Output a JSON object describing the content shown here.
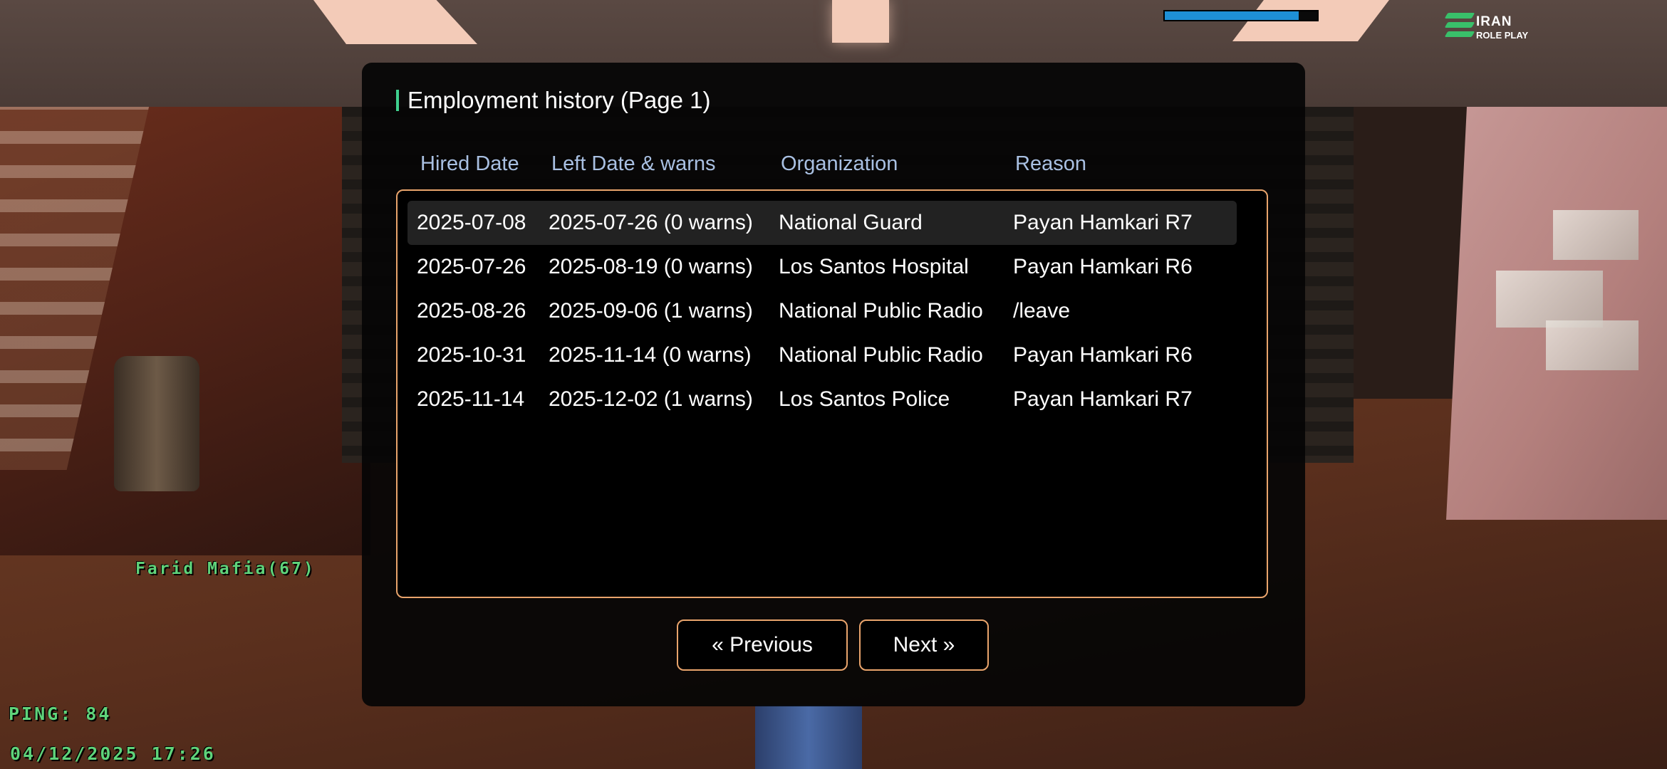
{
  "hud": {
    "health_percent": 0.88,
    "health_color": "#1e8fd6",
    "logo_line1": "IRAN",
    "logo_line2": "ROLE PLAY",
    "player_name": "Farid Mafia(67)",
    "ping": "PING: 84",
    "datetime": "04/12/2025 17:26",
    "hud_text_color": "#5fd37a"
  },
  "dialog": {
    "title": "Employment history (Page 1)",
    "accent_color": "#3fd08e",
    "border_color": "#e9a46c",
    "headers": [
      "Hired Date",
      "Left Date & warns",
      "Organization",
      "Reason"
    ],
    "rows": [
      {
        "hired": "2025-07-08",
        "left": "2025-07-26 (0 warns)",
        "org": "National Guard",
        "reason": "Payan Hamkari R7"
      },
      {
        "hired": "2025-07-26",
        "left": "2025-08-19 (0 warns)",
        "org": "Los Santos Hospital",
        "reason": "Payan Hamkari R6"
      },
      {
        "hired": "2025-08-26",
        "left": "2025-09-06 (1 warns)",
        "org": "National Public Radio",
        "reason": "/leave"
      },
      {
        "hired": "2025-10-31",
        "left": "2025-11-14 (0 warns)",
        "org": "National Public Radio",
        "reason": "Payan Hamkari R6"
      },
      {
        "hired": "2025-11-14",
        "left": "2025-12-02 (1 warns)",
        "org": "Los Santos Police",
        "reason": "Payan Hamkari R7"
      }
    ],
    "selected_row": 0,
    "prev_label": "« Previous",
    "next_label": "Next »"
  }
}
